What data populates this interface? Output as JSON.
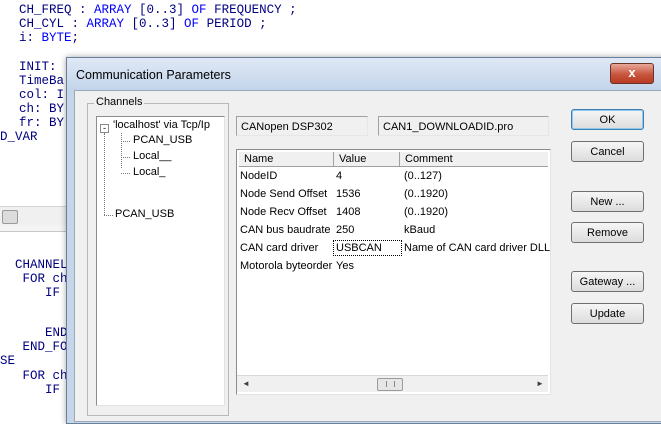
{
  "editor": {
    "lines": [
      {
        "a": "  CH_FREQ : ",
        "k": "ARRAY",
        "b": " [0..3] ",
        "k2": "OF",
        "c": " FREQUENCY ;"
      },
      {
        "a": "  CH_CYL : ",
        "k": "ARRAY",
        "b": " [0..3] ",
        "k2": "OF",
        "c": " PERIOD ;"
      },
      {
        "a": "  i: ",
        "k": "BYTE",
        "b": ";",
        "k2": "",
        "c": ""
      }
    ],
    "left_fragments": [
      "  INIT:",
      "  TimeBa",
      "  col: I",
      "  ch: BY",
      "  fr: BY",
      "D_VAR"
    ],
    "lower_fragments": [
      "",
      "  CHANNEL",
      "   FOR ch",
      "      IF",
      "",
      "",
      "      END",
      "   END_FO",
      "SE",
      "   FOR ch",
      "      IF"
    ]
  },
  "dialog": {
    "title": "Communication Parameters",
    "close_symbol": "x",
    "channels_label": "Channels",
    "tree": {
      "expander": "-",
      "root": "'localhost' via Tcp/Ip",
      "children": [
        "PCAN_USB",
        "Local__",
        "Local_"
      ],
      "sibling": "PCAN_USB"
    },
    "device_name": "CANopen DSP302",
    "project_file": "CAN1_DOWNLOADID.pro",
    "grid": {
      "columns": [
        "Name",
        "Value",
        "Comment"
      ],
      "rows": [
        {
          "name": "NodeID",
          "value": "4",
          "comment": "(0..127)"
        },
        {
          "name": "Node Send Offset",
          "value": "1536",
          "comment": "(0..1920)"
        },
        {
          "name": "Node Recv Offset",
          "value": "1408",
          "comment": "(0..1920)"
        },
        {
          "name": "CAN bus baudrate",
          "value": "250",
          "comment": "kBaud"
        },
        {
          "name": "CAN card driver",
          "value": "USBCAN",
          "comment": "Name of CAN card driver DLL"
        },
        {
          "name": "Motorola byteorder",
          "value": "Yes",
          "comment": ""
        }
      ],
      "scroll_left": "◄",
      "scroll_right": "►"
    },
    "buttons": {
      "ok": "OK",
      "cancel": "Cancel",
      "new": "New ...",
      "remove": "Remove",
      "gateway": "Gateway ...",
      "update": "Update"
    }
  }
}
